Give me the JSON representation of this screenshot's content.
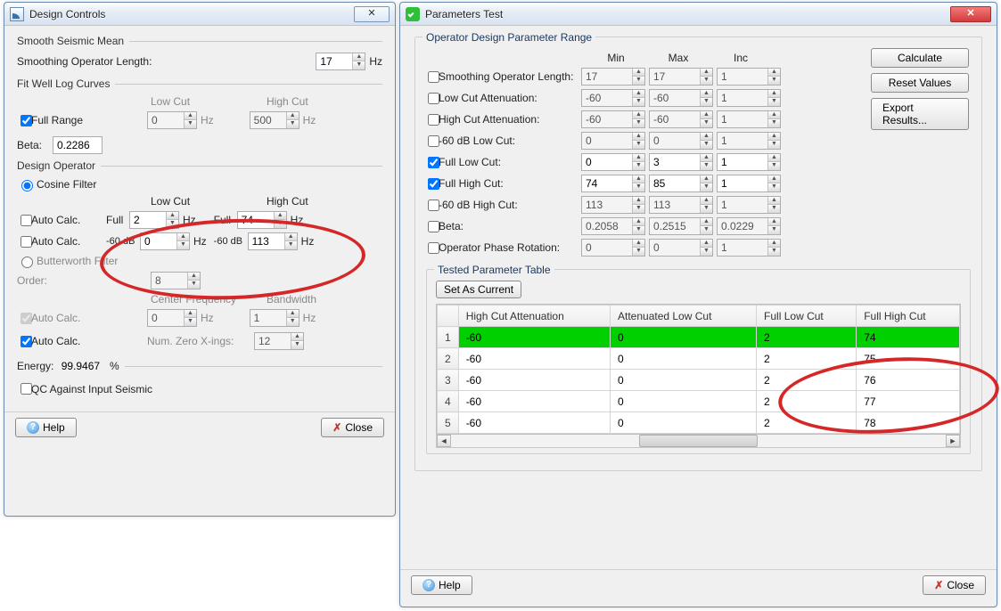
{
  "left_window": {
    "title": "Design Controls",
    "smooth_mean": {
      "title": "Smooth Seismic Mean",
      "op_len_label": "Smoothing Operator Length:",
      "op_len_value": "17",
      "op_len_unit": "Hz"
    },
    "fit_curves": {
      "title": "Fit Well Log Curves",
      "lowcut_hdr": "Low Cut",
      "highcut_hdr": "High Cut",
      "full_range_label": "Full Range",
      "low_val": "0",
      "high_val": "500",
      "unit": "Hz"
    },
    "beta_label": "Beta:",
    "beta_value": "0.2286",
    "design_op": {
      "title": "Design Operator",
      "cosine_label": "Cosine Filter",
      "lowcut_hdr": "Low Cut",
      "highcut_hdr": "High Cut",
      "auto_calc": "Auto Calc.",
      "full_pre": "Full",
      "neg60_pre": "-60 dB",
      "full_low": "2",
      "full_high": "74",
      "neg60_low": "0",
      "neg60_high": "113",
      "unit": "Hz",
      "butter_label": "Butterworth Filter",
      "order_label": "Order:",
      "order_val": "8",
      "cf_hdr": "Center Frequency",
      "bw_hdr": "Bandwidth",
      "cf_val": "0",
      "bw_val": "1",
      "numzero_label": "Num. Zero X-ings:",
      "numzero_val": "12"
    },
    "energy_label": "Energy:",
    "energy_val": "99.9467",
    "energy_unit": "%",
    "qc_label": "QC Against Input Seismic",
    "help_btn": "Help",
    "close_btn": "Close"
  },
  "right_window": {
    "title": "Parameters Test",
    "range_title": "Operator Design Parameter Range",
    "cols": {
      "min": "Min",
      "max": "Max",
      "inc": "Inc"
    },
    "rows": [
      {
        "lbl": "Smoothing Operator Length:",
        "min": "17",
        "max": "17",
        "inc": "1",
        "en": false
      },
      {
        "lbl": "Low Cut Attenuation:",
        "min": "-60",
        "max": "-60",
        "inc": "1",
        "en": false
      },
      {
        "lbl": "High Cut Attenuation:",
        "min": "-60",
        "max": "-60",
        "inc": "1",
        "en": false
      },
      {
        "lbl": "-60 dB Low Cut:",
        "min": "0",
        "max": "0",
        "inc": "1",
        "en": false
      },
      {
        "lbl": "Full Low Cut:",
        "min": "0",
        "max": "3",
        "inc": "1",
        "en": true
      },
      {
        "lbl": "Full High Cut:",
        "min": "74",
        "max": "85",
        "inc": "1",
        "en": true
      },
      {
        "lbl": "-60 dB High Cut:",
        "min": "113",
        "max": "113",
        "inc": "1",
        "en": false
      },
      {
        "lbl": "Beta:",
        "min": "0.2058",
        "max": "0.2515",
        "inc": "0.0229",
        "en": false
      },
      {
        "lbl": "Operator Phase Rotation:",
        "min": "0",
        "max": "0",
        "inc": "1",
        "en": false
      }
    ],
    "calc_btn": "Calculate",
    "reset_btn": "Reset Values",
    "export_btn": "Export Results...",
    "table": {
      "title": "Tested Parameter Table",
      "set_btn": "Set As Current",
      "headers": [
        "High Cut Attenuation",
        "Attenuated Low Cut",
        "Full Low Cut",
        "Full High Cut"
      ],
      "rows": [
        {
          "n": "1",
          "c": [
            "-60",
            "0",
            "2",
            "74"
          ],
          "hl": true
        },
        {
          "n": "2",
          "c": [
            "-60",
            "0",
            "2",
            "75"
          ],
          "hl": false
        },
        {
          "n": "3",
          "c": [
            "-60",
            "0",
            "2",
            "76"
          ],
          "hl": false
        },
        {
          "n": "4",
          "c": [
            "-60",
            "0",
            "2",
            "77"
          ],
          "hl": false
        },
        {
          "n": "5",
          "c": [
            "-60",
            "0",
            "2",
            "78"
          ],
          "hl": false
        }
      ]
    },
    "help_btn": "Help",
    "close_btn": "Close"
  }
}
